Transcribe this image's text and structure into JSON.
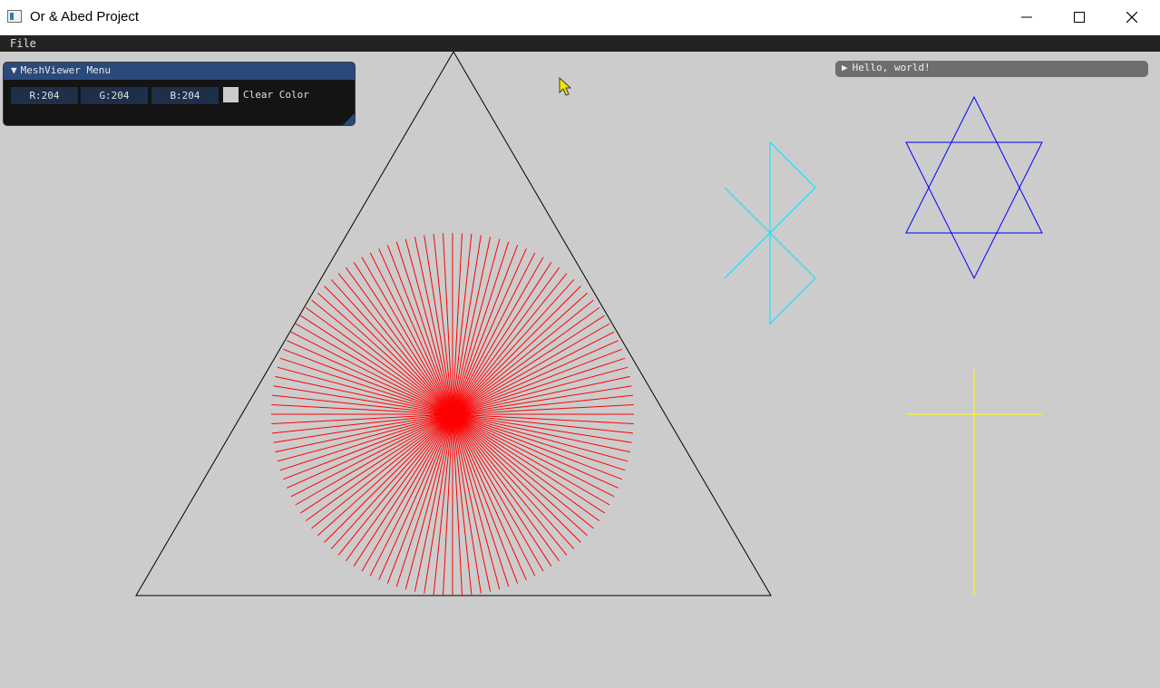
{
  "window": {
    "title": "Or & Abed Project",
    "minimize_icon": "minimize-icon",
    "maximize_icon": "maximize-icon",
    "close_icon": "close-icon"
  },
  "menubar": {
    "file_label": "File"
  },
  "canvas": {
    "background_color": "#cccccc",
    "triangle_color": "#000000",
    "starburst_color": "#ff0000",
    "starburst_line_count": 120,
    "bluetooth_color": "#00e5ff",
    "star_of_david_color": "#0000ff",
    "cross_color": "#ffff00"
  },
  "meshviewer_menu": {
    "title": "MeshViewer Menu",
    "collapse_icon": "triangle-down-icon",
    "r_value": "R:204",
    "g_value": "G:204",
    "b_value": "B:204",
    "swatch_color": "#cccccc",
    "swatch_label": "Clear Color"
  },
  "hello_window": {
    "title": "Hello, world!",
    "expand_icon": "triangle-right-icon"
  }
}
